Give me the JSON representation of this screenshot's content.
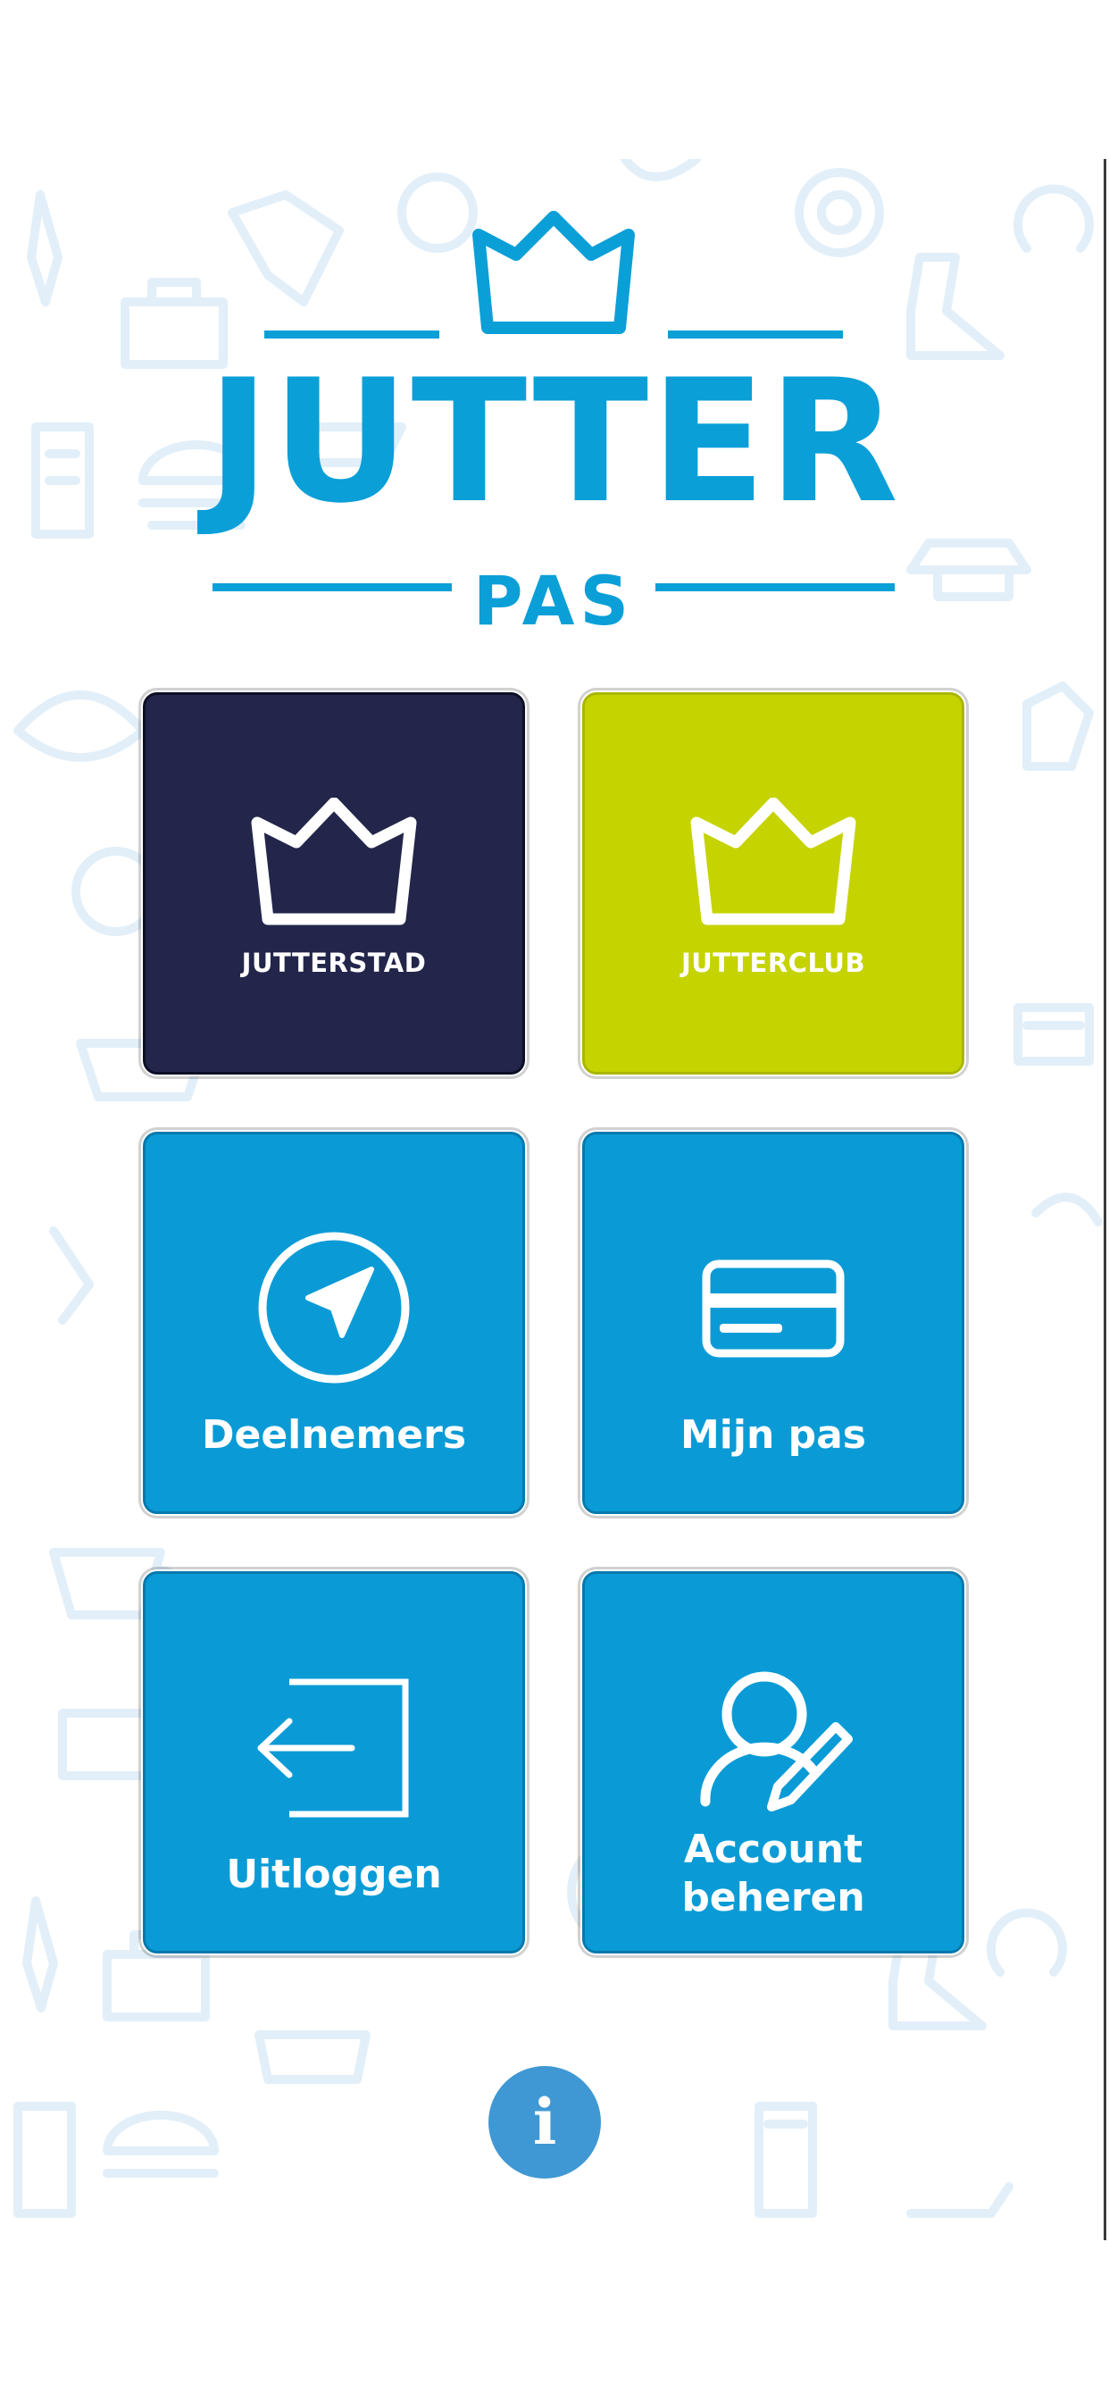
{
  "app": {
    "logo": {
      "title": "JUTTER",
      "subtitle": "PAS"
    }
  },
  "tiles": [
    {
      "label": "JUTTERSTAD",
      "icon": "crown-icon",
      "color": "#23264a"
    },
    {
      "label": "JUTTERCLUB",
      "icon": "crown-icon",
      "color": "#c5d300"
    },
    {
      "label": "Deelnemers",
      "icon": "navigation-arrow-icon",
      "color": "#0a9bd6"
    },
    {
      "label": "Mijn pas",
      "icon": "card-icon",
      "color": "#0a9bd6"
    },
    {
      "label": "Uitloggen",
      "icon": "logout-icon",
      "color": "#0a9bd6"
    },
    {
      "label_line1": "Account",
      "label_line2": "beheren",
      "icon": "user-edit-icon",
      "color": "#0a9bd6"
    }
  ],
  "info_button": {
    "label": "i",
    "icon": "info-icon",
    "color": "#3f98d4"
  },
  "colors": {
    "brand_blue": "#0b9fd8",
    "pattern": "#e4f1fa"
  }
}
